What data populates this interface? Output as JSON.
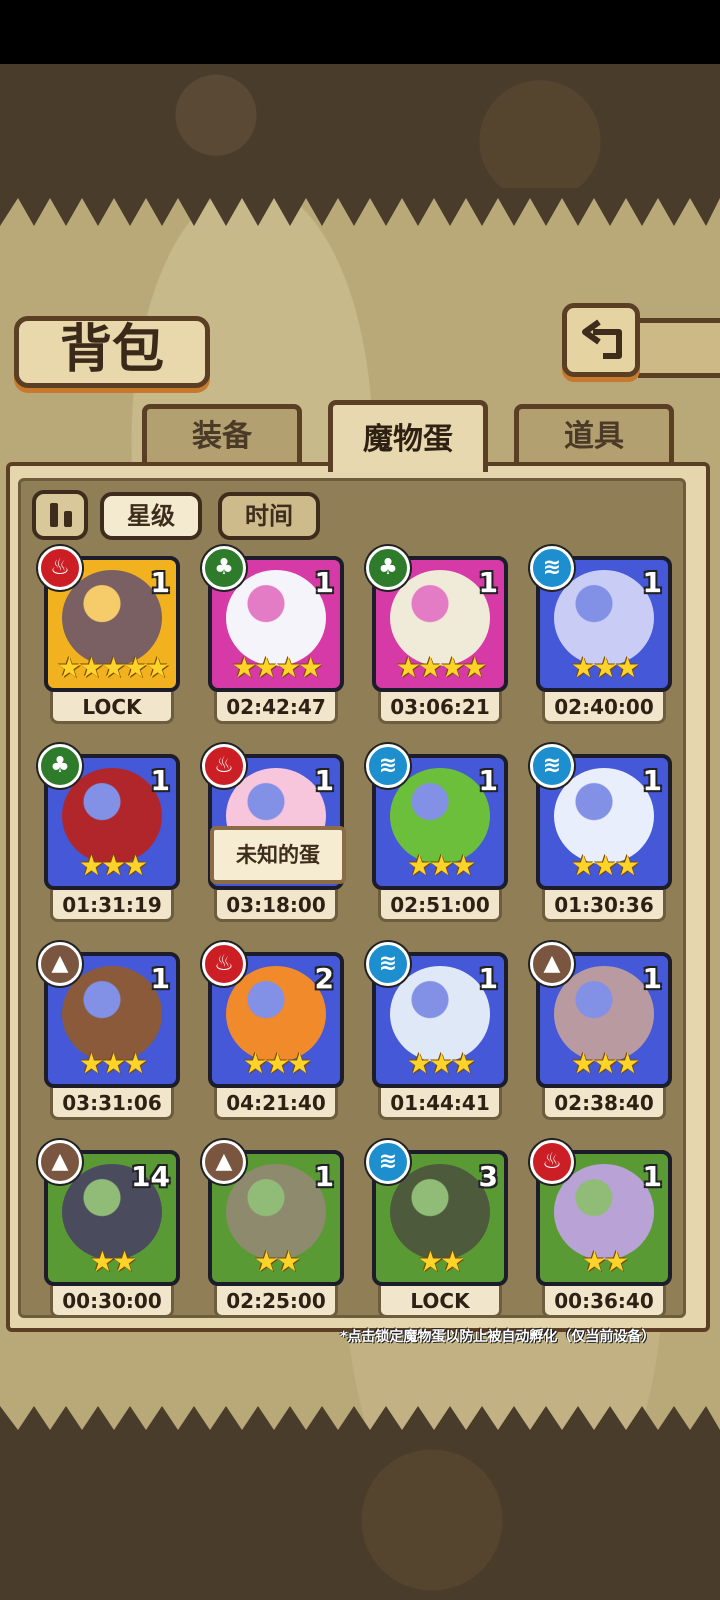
{
  "title": "背包",
  "tabs": [
    {
      "label": "装备",
      "active": false
    },
    {
      "label": "魔物蛋",
      "active": true
    },
    {
      "label": "道具",
      "active": false
    }
  ],
  "sort": {
    "options": [
      "星级",
      "时间"
    ],
    "selected": "星级"
  },
  "tooltip": "未知的蛋",
  "footnote": "*点击锁定魔物蛋以防止被自动孵化（仅当前设备）",
  "colors": {
    "fire": "#cc1f25",
    "leaf": "#2e7b2c",
    "water": "#1d8fce",
    "earth": "#7a5640",
    "rarity_gold": "#f2b21f",
    "rarity_pink": "#d53aa6",
    "rarity_blue": "#4458d8",
    "rarity_green": "#5a9a34"
  },
  "eggs": [
    {
      "element": "fire-icon",
      "rarity": "gold",
      "stars": "★★★★★",
      "qty": "1",
      "timer": "LOCK"
    },
    {
      "element": "leaf-icon",
      "rarity": "pink",
      "stars": "★★★★",
      "qty": "1",
      "timer": "02:42:47"
    },
    {
      "element": "leaf-icon",
      "rarity": "pink",
      "stars": "★★★★",
      "qty": "1",
      "timer": "03:06:21"
    },
    {
      "element": "water-icon",
      "rarity": "blue",
      "stars": "★★★",
      "qty": "1",
      "timer": "02:40:00"
    },
    {
      "element": "leaf-icon",
      "rarity": "blue",
      "stars": "★★★",
      "qty": "1",
      "timer": "01:31:19"
    },
    {
      "element": "fire-icon",
      "rarity": "blue",
      "stars": "★★★",
      "qty": "1",
      "timer": "03:18:00"
    },
    {
      "element": "water-icon",
      "rarity": "blue",
      "stars": "★★★",
      "qty": "1",
      "timer": "02:51:00"
    },
    {
      "element": "water-icon",
      "rarity": "blue",
      "stars": "★★★",
      "qty": "1",
      "timer": "01:30:36"
    },
    {
      "element": "earth-icon",
      "rarity": "blue",
      "stars": "★★★",
      "qty": "1",
      "timer": "03:31:06"
    },
    {
      "element": "fire-icon",
      "rarity": "blue",
      "stars": "★★★",
      "qty": "2",
      "timer": "04:21:40"
    },
    {
      "element": "water-icon",
      "rarity": "blue",
      "stars": "★★★",
      "qty": "1",
      "timer": "01:44:41"
    },
    {
      "element": "earth-icon",
      "rarity": "blue",
      "stars": "★★★",
      "qty": "1",
      "timer": "02:38:40"
    },
    {
      "element": "earth-icon",
      "rarity": "green",
      "stars": "★★",
      "qty": "14",
      "timer": "00:30:00"
    },
    {
      "element": "earth-icon",
      "rarity": "green",
      "stars": "★★",
      "qty": "1",
      "timer": "02:25:00"
    },
    {
      "element": "water-icon",
      "rarity": "green",
      "stars": "★★",
      "qty": "3",
      "timer": "LOCK"
    },
    {
      "element": "fire-icon",
      "rarity": "green",
      "stars": "★★",
      "qty": "1",
      "timer": "00:36:40"
    }
  ]
}
